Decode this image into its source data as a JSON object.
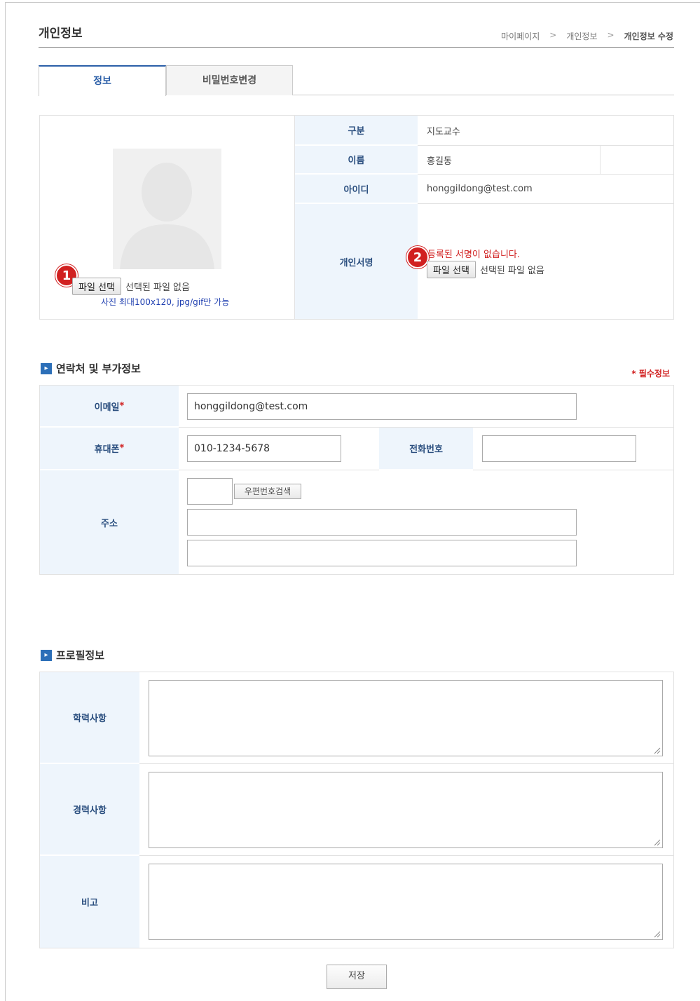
{
  "page": {
    "title": "개인정보",
    "breadcrumb": [
      "마이페이지",
      "개인정보",
      "개인정보 수정"
    ],
    "breadcrumb_separator": ">"
  },
  "tabs": [
    {
      "label": "정보",
      "active": true
    },
    {
      "label": "비밀번호변경",
      "active": false
    }
  ],
  "profile": {
    "photo_file_button": "파일 선택",
    "photo_file_status": "선택된 파일 없음",
    "photo_hint": "사진 최대100x120, jpg/gif만 가능",
    "badge_1": "1",
    "badge_2": "2",
    "rows": {
      "category_label": "구분",
      "category_value": "지도교수",
      "name_label": "이름",
      "name_value": "홍길동",
      "id_label": "아이디",
      "id_value": "honggildong@test.com",
      "signature_label": "개인서명",
      "signature_notice": "등록된 서명이 없습니다.",
      "signature_file_button": "파일 선택",
      "signature_file_status": "선택된 파일 없음"
    }
  },
  "contact": {
    "section_title": "연락처 및 부가정보",
    "required_note": "* 필수정보",
    "required_mark": "*",
    "email_label": "이메일",
    "email_value": "honggildong@test.com",
    "mobile_label": "휴대폰",
    "mobile_value": "010-1234-5678",
    "phone_label": "전화번호",
    "phone_value": "",
    "address_label": "주소",
    "zip_value": "",
    "zip_search_button": "우편번호검색",
    "address1_value": "",
    "address2_value": ""
  },
  "profile_info": {
    "section_title": "프로필정보",
    "education_label": "학력사항",
    "career_label": "경력사항",
    "note_label": "비고"
  },
  "actions": {
    "save_label": "저장"
  },
  "colors": {
    "label_bg": "#eef5fc",
    "label_text": "#2b4f7f",
    "accent": "#2c5fa8",
    "required": "#d12020"
  }
}
